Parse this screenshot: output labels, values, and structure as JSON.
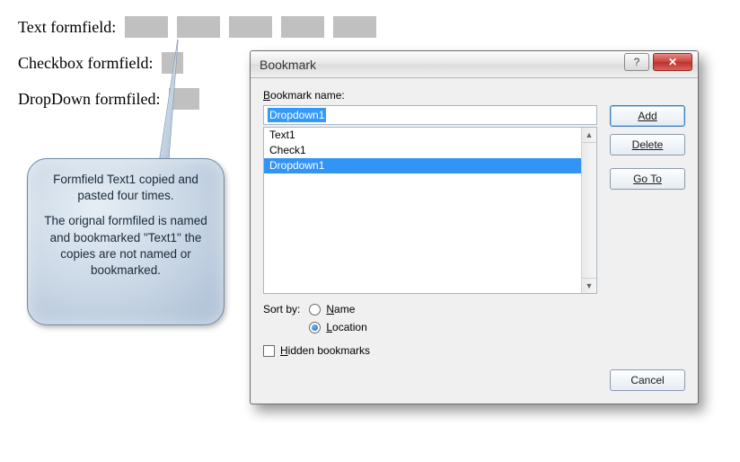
{
  "doc": {
    "text_label": "Text formfield:",
    "checkbox_label": "Checkbox formfield:",
    "dropdown_label": "DropDown formfiled:"
  },
  "callout": {
    "p1": "Formfield Text1 copied and pasted four times.",
    "p2": "The orignal formfiled is named and bookmarked \"Text1\"  the copies are not named or bookmarked."
  },
  "dialog": {
    "title": "Bookmark",
    "bookmark_name_label_pre": "B",
    "bookmark_name_label_post": "ookmark name:",
    "input_value": "Dropdown1",
    "list": [
      "Text1",
      "Check1",
      "Dropdown1"
    ],
    "selected_index": 2,
    "add": "Add",
    "delete": "Delete",
    "goto": "Go To",
    "sort_label": "Sort by:",
    "sort_name_u": "N",
    "sort_name_rest": "ame",
    "sort_location_u": "L",
    "sort_location_rest": "ocation",
    "hidden_u": "H",
    "hidden_rest": "idden bookmarks",
    "cancel": "Cancel"
  }
}
